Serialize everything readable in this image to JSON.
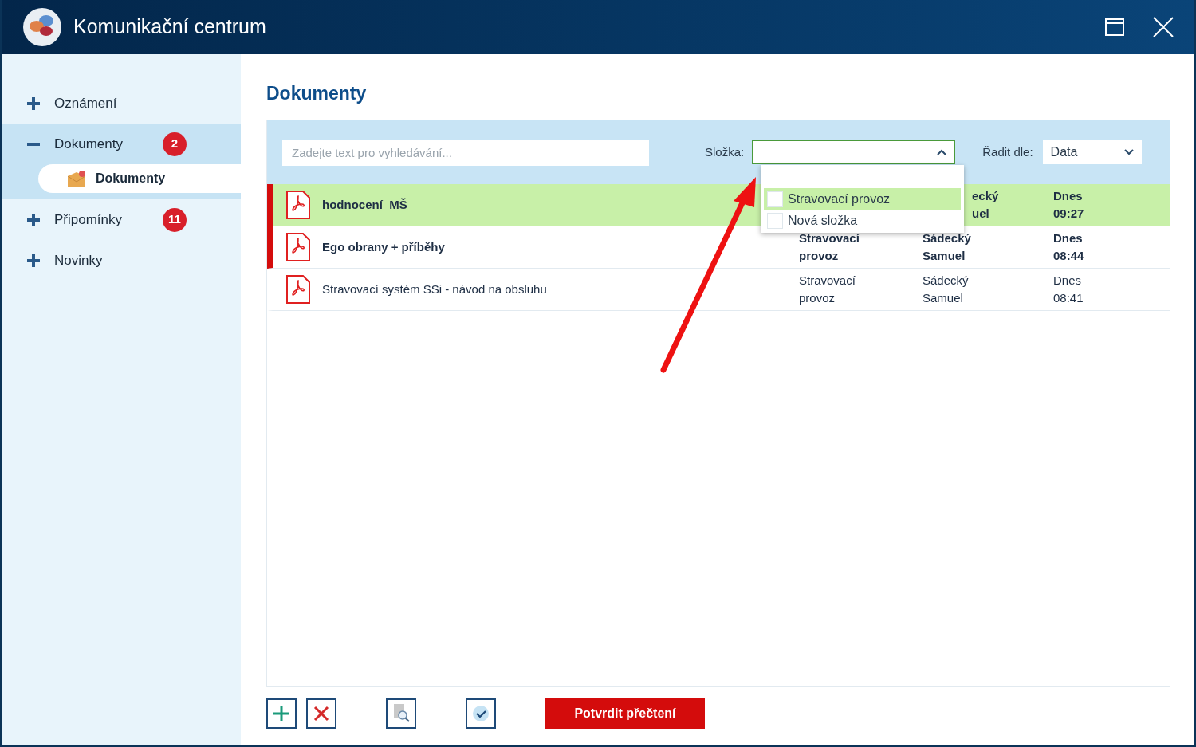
{
  "window": {
    "title": "Komunikační centrum"
  },
  "sidebar": {
    "items": [
      {
        "label": "Oznámení",
        "expanded": false,
        "selected": false
      },
      {
        "label": "Dokumenty",
        "expanded": true,
        "selected": true,
        "badge": "2",
        "children": [
          {
            "label": "Dokumenty",
            "selected": true
          }
        ]
      },
      {
        "label": "Připomínky",
        "expanded": false,
        "selected": false,
        "badge": "11"
      },
      {
        "label": "Novinky",
        "expanded": false,
        "selected": false
      }
    ]
  },
  "page_title": "Dokumenty",
  "toolbar": {
    "search": {
      "placeholder": "Zadejte text pro vyhledávání..."
    },
    "folder": {
      "label": "Složka:",
      "expanded": true,
      "options": [
        {
          "label": "Stravovací provoz",
          "selected": true,
          "checked": false
        },
        {
          "label": "Nová složka",
          "selected": false,
          "checked": false
        }
      ]
    },
    "sort": {
      "label": "Řadit dle:",
      "value": "Data"
    }
  },
  "rows": [
    {
      "name": "hodnocení_MŠ",
      "unread": true,
      "selected": true,
      "author": [
        "ecký",
        "uel"
      ],
      "date": [
        "Dnes",
        "09:27"
      ]
    },
    {
      "name": "Ego obrany + příběhy",
      "unread": true,
      "selected": false,
      "folder": [
        "Stravovací",
        "provoz"
      ],
      "author": [
        "Sádecký",
        "Samuel"
      ],
      "date": [
        "Dnes",
        "08:44"
      ]
    },
    {
      "name": "Stravovací systém SSi - návod na obsluhu",
      "unread": false,
      "selected": false,
      "folder": [
        "Stravovací",
        "provoz"
      ],
      "author": [
        "Sádecký",
        "Samuel"
      ],
      "date": [
        "Dnes",
        "08:41"
      ]
    }
  ],
  "confirm_button": "Potvrdit přečtení"
}
